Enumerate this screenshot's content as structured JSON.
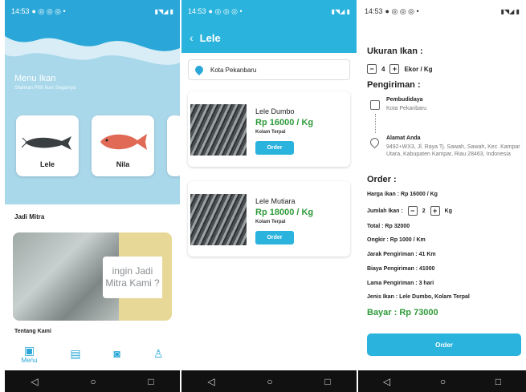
{
  "status": {
    "time": "14:53"
  },
  "menu": {
    "title": "Menu Ikan",
    "subtitle": "Silahkan Pilih Ikan Segarnya",
    "fish": [
      "Lele",
      "Nila"
    ],
    "mitra_heading": "Jadi Mitra",
    "banner_line1": "ingin Jadi",
    "banner_line2": "Mitra Kami ?",
    "tentang": "Tentang Kami",
    "nav_menu_label": "Menu"
  },
  "list": {
    "title": "Lele",
    "location": "Kota Pekanbaru",
    "products": [
      {
        "name": "Lele Dumbo",
        "price": "Rp 16000 / Kg",
        "type": "Kolam Terpal",
        "button": "Order"
      },
      {
        "name": "Lele Mutiara",
        "price": "Rp 18000 / Kg",
        "type": "Kolam Terpal",
        "button": "Order"
      }
    ]
  },
  "order": {
    "ukuran_heading": "Ukuran Ikan :",
    "ukuran_value": "4",
    "ukuran_unit": "Ekor / Kg",
    "pengiriman_heading": "Pengiriman :",
    "from_title": "Pembudidaya",
    "from_sub": "Kota Pekanbaru",
    "to_title": "Alamat Anda",
    "to_sub": "9492+WX3, Jl. Raya Tj. Sawah, Sawah, Kec. Kampar Utara, Kabupaten Kampar, Riau 28463, Indonesia",
    "order_heading": "Order :",
    "harga": "Harga ikan : Rp 16000 / Kg",
    "jumlah_label": "Jumlah Ikan :",
    "jumlah_value": "2",
    "jumlah_unit": "Kg",
    "total": "Total : Rp 32000",
    "ongkir": "Ongkir : Rp 1000 / Km",
    "jarak": "Jarak Pengiriman :  41 Km",
    "biaya": "Biaya Pengiriman :  41000",
    "lama": "Lama Pengiriman :  3 hari",
    "jenis": "Jenis Ikan : Lele Dumbo,  Kolam Terpal",
    "bayar": "Bayar : Rp 73000",
    "button": "Order"
  },
  "colors": {
    "primary": "#29b3dd",
    "header": "#a9d8ea",
    "price": "#2e9a3a"
  }
}
